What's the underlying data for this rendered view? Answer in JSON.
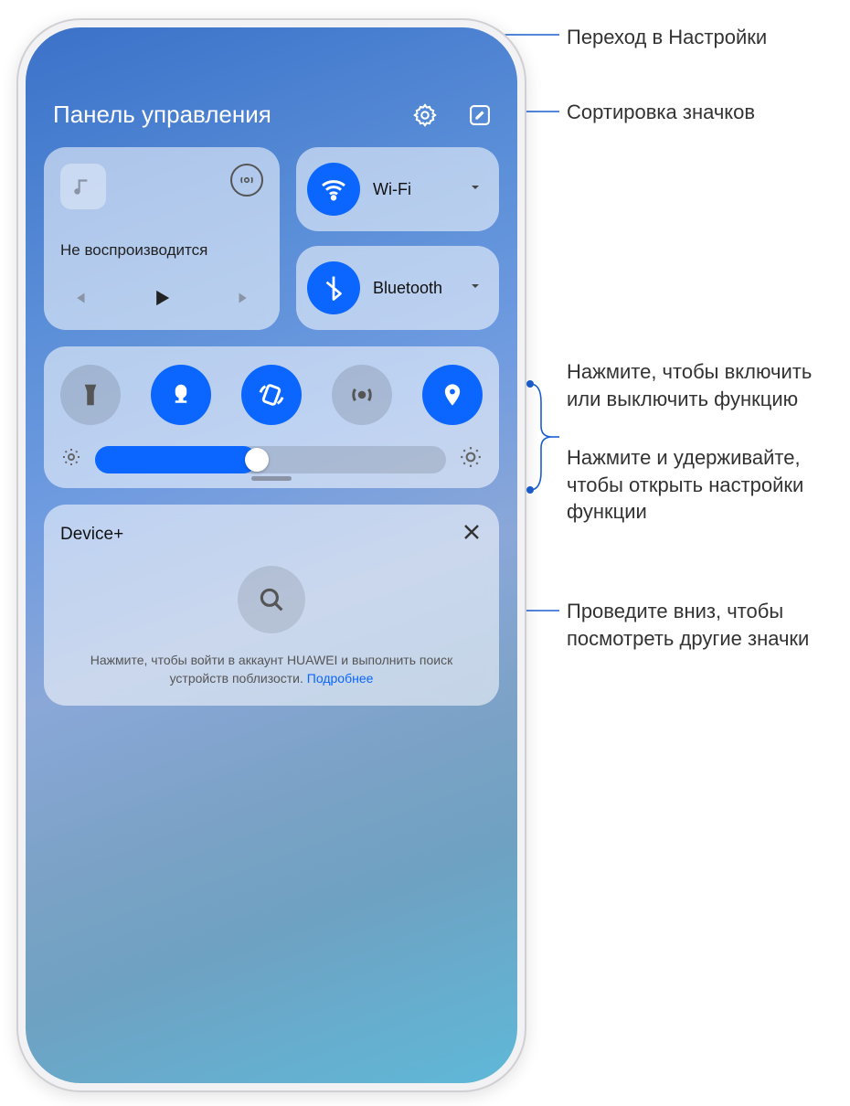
{
  "header": {
    "title": "Панель управления"
  },
  "media": {
    "status": "Не воспроизводится"
  },
  "conn": {
    "wifi": "Wi-Fi",
    "bt": "Bluetooth"
  },
  "device": {
    "title": "Device+",
    "text_a": "Нажмите, чтобы войти в аккаунт HUAWEI и выполнить поиск устройств поблизости. ",
    "link": "Подробнее"
  },
  "annot": {
    "a1": "Переход в Настройки",
    "a2": "Сортировка значков",
    "a3": "Нажмите, чтобы включить или выключить функцию",
    "a4": "Нажмите и удерживайте, чтобы открыть настройки функции",
    "a5": "Проведите вниз, чтобы посмотреть другие значки"
  },
  "brightness": {
    "value_pct": 46
  }
}
